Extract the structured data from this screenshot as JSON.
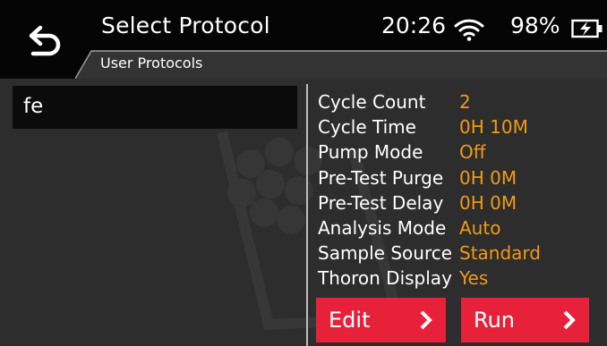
{
  "header": {
    "title": "Select Protocol",
    "time": "20:26",
    "battery_percent": "98%",
    "subtitle": "User Protocols",
    "icons": [
      "back-arrow-icon",
      "wifi-icon",
      "battery-charging-icon"
    ]
  },
  "protocols": [
    {
      "name": "fe",
      "selected": true
    }
  ],
  "settings": [
    {
      "label": "Cycle Count",
      "value": "2"
    },
    {
      "label": "Cycle Time",
      "value": "0H 10M"
    },
    {
      "label": "Pump Mode",
      "value": "Off"
    },
    {
      "label": "Pre-Test Purge",
      "value": "0H 0M"
    },
    {
      "label": "Pre-Test Delay",
      "value": "0H 0M"
    },
    {
      "label": "Analysis Mode",
      "value": "Auto"
    },
    {
      "label": "Sample Source",
      "value": "Standard"
    },
    {
      "label": "Thoron Display",
      "value": "Yes"
    }
  ],
  "buttons": {
    "edit_label": "Edit",
    "run_label": "Run",
    "arrow_icon": "chevron-right-icon"
  },
  "colors": {
    "accent_button": "#e8213a",
    "value_text": "#f29a18",
    "header_bg": "#050505",
    "body_bg": "#2d2d2d"
  }
}
